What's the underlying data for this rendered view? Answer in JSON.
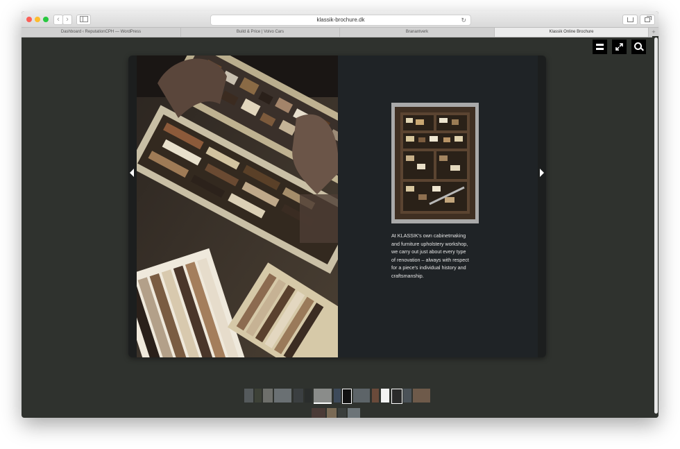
{
  "browser": {
    "url": "klassik-brochure.dk",
    "tabs": [
      {
        "label": "Dashboard ‹ ReputationCPH — WordPress",
        "active": false
      },
      {
        "label": "Build & Price | Volvo Cars",
        "active": false
      },
      {
        "label": "Branantverk",
        "active": false
      },
      {
        "label": "Klassik Online Brochure",
        "active": true
      }
    ],
    "tab_add_label": "+",
    "back_label": "‹",
    "forward_label": "›",
    "reload_label": "↻"
  },
  "viewer": {
    "controls": [
      "pages-icon",
      "fullscreen-icon",
      "search-icon"
    ]
  },
  "spread": {
    "caption_lines": [
      "At KLASSIK's own cabinetmaking",
      "and furniture upholstery workshop,",
      "we carry out just about every type",
      "of renovation – always with respect",
      "for a piece's individual history and",
      "craftsmanship."
    ]
  },
  "colors": {
    "background": "#2f322e",
    "page_dark": "#1f2326",
    "caption_text": "#e6e6e6"
  }
}
